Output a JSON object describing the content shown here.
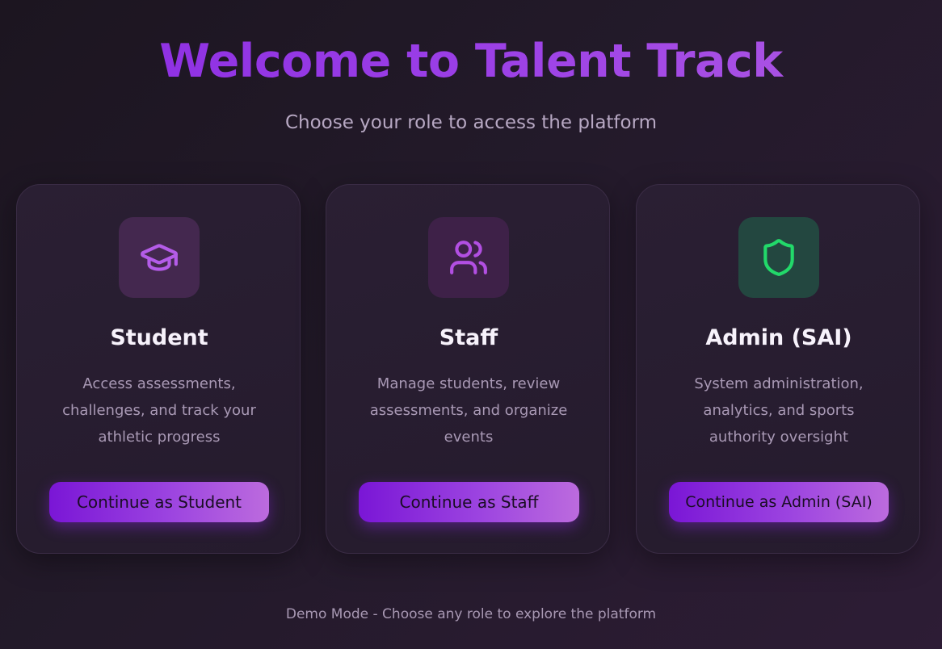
{
  "header": {
    "title": "Welcome to Talent Track",
    "subtitle": "Choose your role to access the platform"
  },
  "roles": [
    {
      "title": "Student",
      "description": "Access assessments, challenges, and track your athletic progress",
      "button_label": "Continue as Student",
      "icon": "graduation-cap-icon",
      "icon_color": "#b45ce8",
      "icon_bg": "#44284f"
    },
    {
      "title": "Staff",
      "description": "Manage students, review assessments, and organize events",
      "button_label": "Continue as Staff",
      "icon": "users-icon",
      "icon_color": "#b24fe2",
      "icon_bg": "#3e2148"
    },
    {
      "title": "Admin (SAI)",
      "description": "System administration, analytics, and sports authority oversight",
      "button_label": "Continue as Admin (SAI)",
      "icon": "shield-icon",
      "icon_color": "#22d96a",
      "icon_bg": "#234740"
    }
  ],
  "footer": {
    "note": "Demo Mode - Choose any role to explore the platform"
  },
  "colors": {
    "accent": "#8a2be2",
    "background": "#201824"
  }
}
